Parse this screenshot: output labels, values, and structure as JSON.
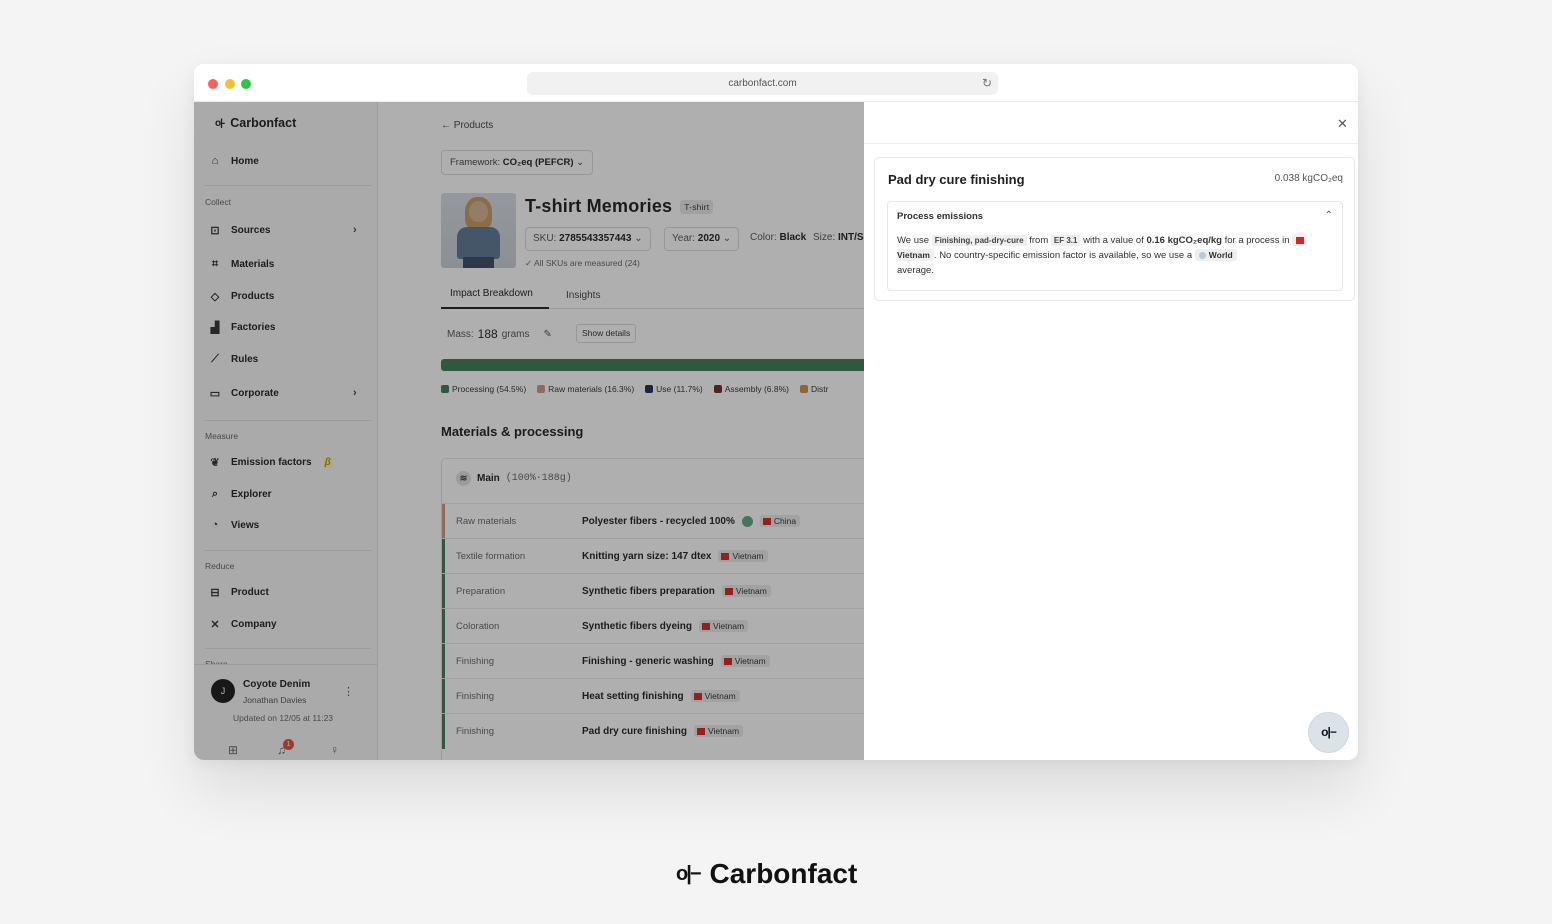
{
  "browser": {
    "url": "carbonfact.com"
  },
  "sidebar": {
    "brand": "Carbonfact",
    "home": "Home",
    "sections": {
      "collect": "Collect",
      "measure": "Measure",
      "reduce": "Reduce",
      "share": "Share"
    },
    "collect_items": [
      "Sources",
      "Materials",
      "Products",
      "Factories",
      "Rules",
      "Corporate"
    ],
    "measure_items": [
      "Emission factors",
      "Explorer",
      "Views"
    ],
    "beta_badge": "β",
    "reduce_items": [
      "Product",
      "Company"
    ],
    "user": {
      "initial": "J",
      "company": "Coyote Denim",
      "name": "Jonathan Davies",
      "updated": "Updated on 12/05 at 11:23",
      "notifications": "1"
    }
  },
  "main": {
    "breadcrumb": "← Products",
    "framework_label": "Framework:",
    "framework_value": "CO₂eq (PEFCR)",
    "product_title": "T-shirt Memories",
    "product_tag": "T-shirt",
    "sku_label": "SKU:",
    "sku_value": "2785543357443",
    "year_label": "Year:",
    "year_value": "2020",
    "color_label": "Color:",
    "color_value": "Black",
    "size_label": "Size:",
    "size_value": "INT/S",
    "measured": "All SKUs are measured (24)",
    "tabs": [
      "Impact Breakdown",
      "Insights"
    ],
    "mass_label": "Mass:",
    "mass_value": "188",
    "mass_unit": "grams",
    "show_details": "Show details",
    "legend": [
      {
        "label": "Processing (54.5%)",
        "color": "#3f7a55"
      },
      {
        "label": "Raw materials (16.3%)",
        "color": "#d4967d"
      },
      {
        "label": "Use (11.7%)",
        "color": "#1f2a5c"
      },
      {
        "label": "Assembly (6.8%)",
        "color": "#6e2b2b"
      },
      {
        "label": "Distr",
        "color": "#c9924a"
      }
    ],
    "materials_heading": "Materials & processing",
    "main_group": "Main",
    "main_group_pct": "(100%·188g)",
    "rows": [
      {
        "stage": "Raw materials",
        "name": "Polyester fibers - recycled 100%",
        "country": "China"
      },
      {
        "stage": "Textile formation",
        "name": "Knitting yarn size: 147 dtex",
        "country": "Vietnam"
      },
      {
        "stage": "Preparation",
        "name": "Synthetic fibers preparation",
        "country": "Vietnam"
      },
      {
        "stage": "Coloration",
        "name": "Synthetic fibers dyeing",
        "country": "Vietnam"
      },
      {
        "stage": "Finishing",
        "name": "Finishing - generic washing",
        "country": "Vietnam"
      },
      {
        "stage": "Finishing",
        "name": "Heat setting finishing",
        "country": "Vietnam"
      },
      {
        "stage": "Finishing",
        "name": "Pad dry cure finishing",
        "country": "Vietnam"
      }
    ]
  },
  "panel": {
    "title": "Pad dry cure finishing",
    "value": "0.038 kgCO₂eq",
    "section": "Process emissions",
    "text_we_use": "We use",
    "code1": "Finishing, pad-dry-cure",
    "text_from": "from",
    "code2": "EF 3.1",
    "text_value": "with a value of",
    "value_bold": "0.16 kgCO₂eq/kg",
    "text_process": "for a process in",
    "country": "Vietnam",
    "text_no_factor": ". No country-specific emission factor is available, so we use a",
    "world": "World",
    "text_average": "average."
  },
  "footer": {
    "brand": "Carbonfact"
  }
}
